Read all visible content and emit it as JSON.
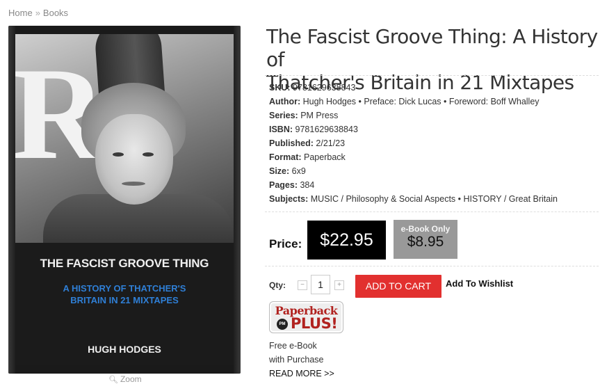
{
  "breadcrumb": {
    "home": "Home",
    "separator": "»",
    "current": "Books"
  },
  "cover": {
    "title": "THE FASCIST GROOVE THING",
    "subtitle_line1": "A HISTORY OF THATCHER'S",
    "subtitle_line2": "BRITAIN IN 21 MIXTAPES",
    "author": "HUGH HODGES",
    "photo_letter": "R"
  },
  "zoom": {
    "icon": "magnifier-icon",
    "label": "Zoom"
  },
  "product": {
    "title_line1": "The Fascist Groove Thing: A History of",
    "title_line2": "Thatcher's Britain in 21 Mixtapes"
  },
  "details": [
    {
      "label": "SKU:",
      "value": "9781629638843"
    },
    {
      "label": "Author:",
      "value": "Hugh Hodges • Preface: Dick Lucas • Foreword: Boff Whalley"
    },
    {
      "label": "Series:",
      "value": "PM Press"
    },
    {
      "label": "ISBN:",
      "value": "9781629638843"
    },
    {
      "label": "Published:",
      "value": "2/21/23"
    },
    {
      "label": "Format:",
      "value": "Paperback"
    },
    {
      "label": "Size:",
      "value": "6x9"
    },
    {
      "label": "Pages:",
      "value": "384"
    },
    {
      "label": "Subjects:",
      "value": "MUSIC / Philosophy & Social Aspects • HISTORY / Great Britain"
    }
  ],
  "pricing": {
    "label": "Price:",
    "price": "$22.95",
    "ebook_label": "e-Book Only",
    "ebook_price": "$8.95"
  },
  "cart": {
    "qty_label": "Qty:",
    "qty_value": "1",
    "minus": "−",
    "plus": "+",
    "add_to_cart": "ADD TO CART",
    "wishlist": "Add To Wishlist"
  },
  "promo": {
    "badge_top": "Paperback",
    "badge_pm": "PM",
    "badge_plus": "PLUS!",
    "line1": "Free e-Book",
    "line2": "with Purchase",
    "read_more": "READ MORE >>"
  },
  "colors": {
    "cart_button": "#e2302f",
    "price_box": "#000000",
    "ebook_box": "#999999",
    "cover_subtitle": "#2f7fd6",
    "badge_red": "#b1221f"
  }
}
